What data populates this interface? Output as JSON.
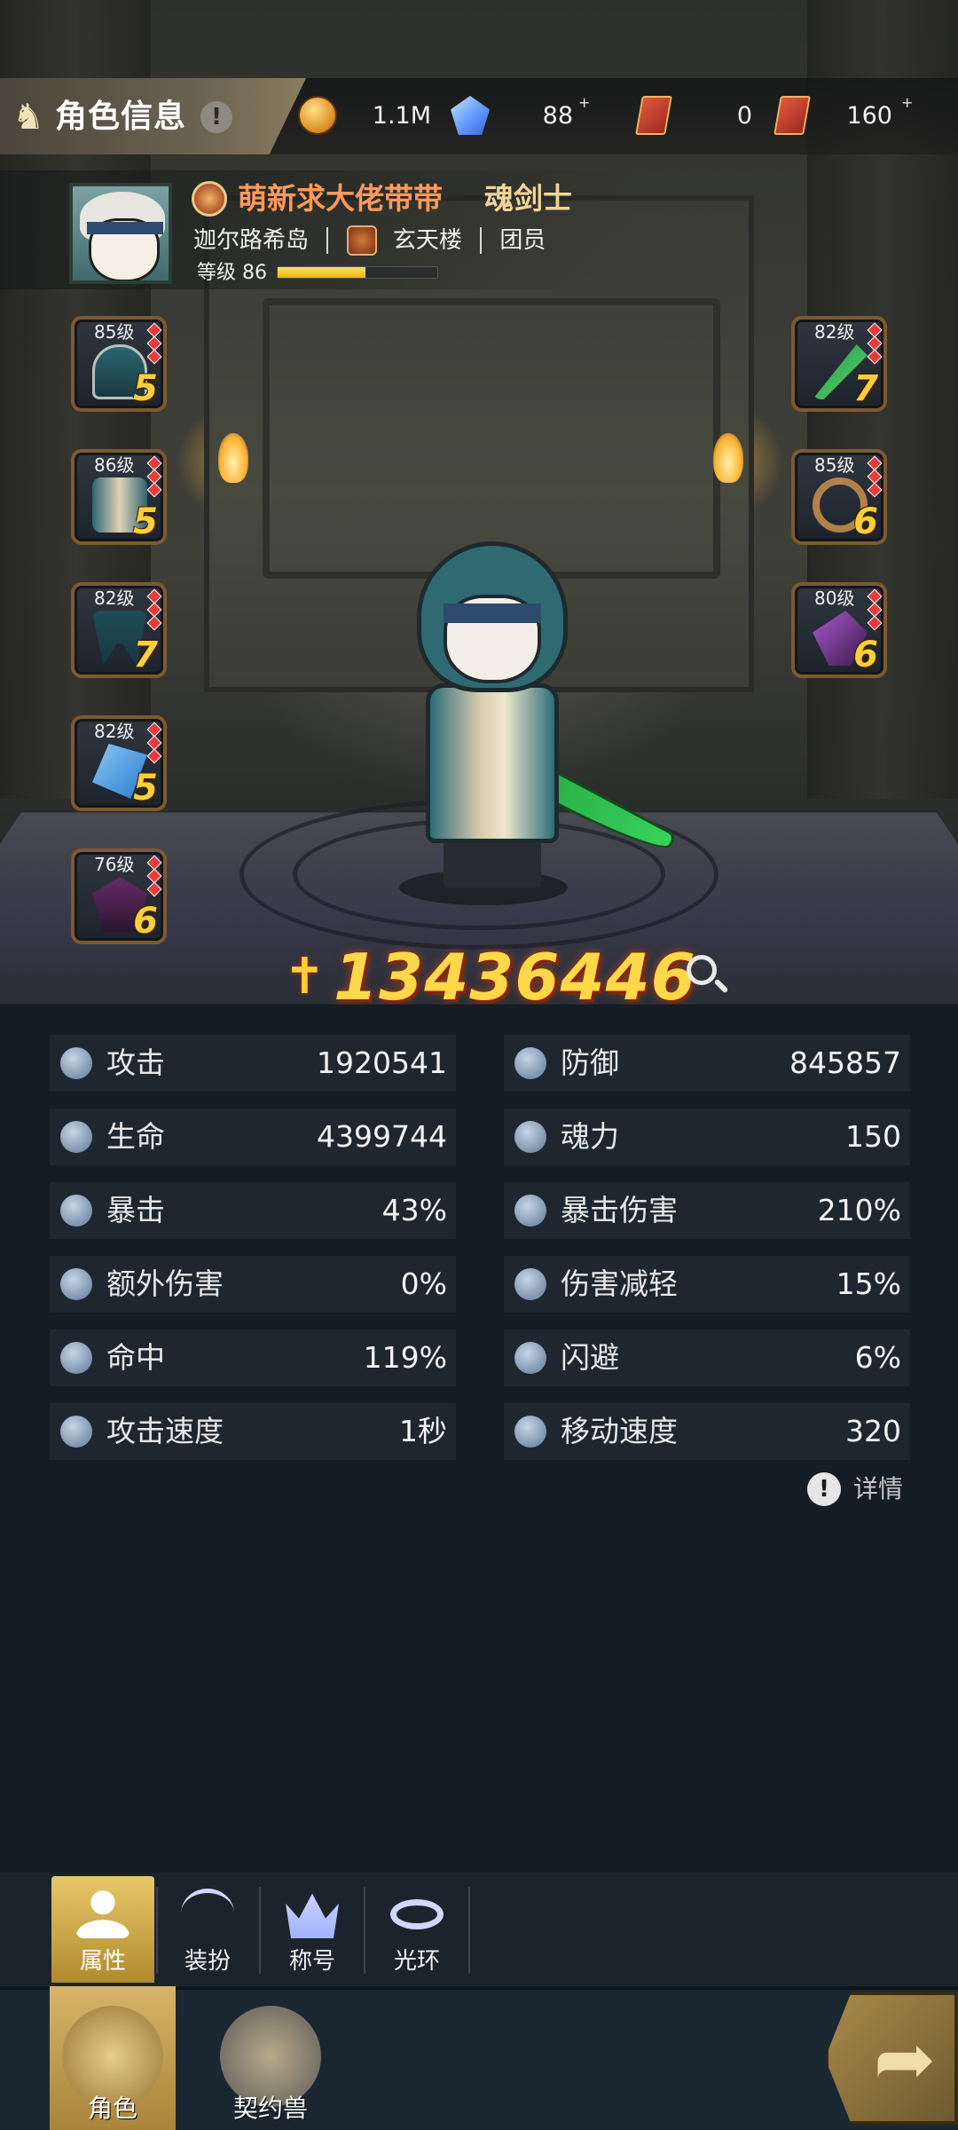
{
  "header": {
    "title": "角色信息",
    "help_icon": "!",
    "resources": [
      {
        "name": "gold-coin",
        "value": "1.1M",
        "has_plus": false
      },
      {
        "name": "diamond",
        "value": "88",
        "has_plus": true
      },
      {
        "name": "red-ticket-1",
        "value": "0",
        "has_plus": false
      },
      {
        "name": "red-ticket-2",
        "value": "160",
        "has_plus": true
      }
    ]
  },
  "profile": {
    "name": "萌新求大佬带带",
    "class": "魂剑士",
    "server": "迦尔路希岛",
    "guild": "玄天楼",
    "role": "团员",
    "level_label": "等级 86",
    "level_progress": 0.55
  },
  "equipment": {
    "left": [
      {
        "level": "85级",
        "stars": "5",
        "icon": "armor-icon"
      },
      {
        "level": "86级",
        "stars": "5",
        "icon": "robe-icon"
      },
      {
        "level": "82级",
        "stars": "7",
        "icon": "legs-icon"
      },
      {
        "level": "82级",
        "stars": "5",
        "icon": "gauntlet-icon"
      },
      {
        "level": "76级",
        "stars": "6",
        "icon": "cape-icon"
      }
    ],
    "right": [
      {
        "level": "82级",
        "stars": "7",
        "icon": "sword-icon"
      },
      {
        "level": "85级",
        "stars": "6",
        "icon": "ring-icon"
      },
      {
        "level": "80级",
        "stars": "6",
        "icon": "necklace-icon"
      }
    ]
  },
  "power": {
    "value": "13436446"
  },
  "stats": {
    "left": [
      {
        "label": "攻击",
        "value": "1920541"
      },
      {
        "label": "生命",
        "value": "4399744"
      },
      {
        "label": "暴击",
        "value": "43%"
      },
      {
        "label": "额外伤害",
        "value": "0%"
      },
      {
        "label": "命中",
        "value": "119%"
      },
      {
        "label": "攻击速度",
        "value": "1秒"
      }
    ],
    "right": [
      {
        "label": "防御",
        "value": "845857"
      },
      {
        "label": "魂力",
        "value": "150"
      },
      {
        "label": "暴击伤害",
        "value": "210%"
      },
      {
        "label": "伤害减轻",
        "value": "15%"
      },
      {
        "label": "闪避",
        "value": "6%"
      },
      {
        "label": "移动速度",
        "value": "320"
      }
    ]
  },
  "detail_link": {
    "label": "详情"
  },
  "subtabs": [
    {
      "label": "属性",
      "active": true
    },
    {
      "label": "装扮",
      "active": false
    },
    {
      "label": "称号",
      "active": false
    },
    {
      "label": "光环",
      "active": false
    }
  ],
  "bottom_nav": [
    {
      "label": "角色",
      "active": true
    },
    {
      "label": "契约兽",
      "active": false
    }
  ],
  "colors": {
    "accent_gold": "#ffd84a",
    "player_name": "#ff9a5a",
    "class_name": "#f3d59a",
    "panel_bg": "#141c24"
  }
}
